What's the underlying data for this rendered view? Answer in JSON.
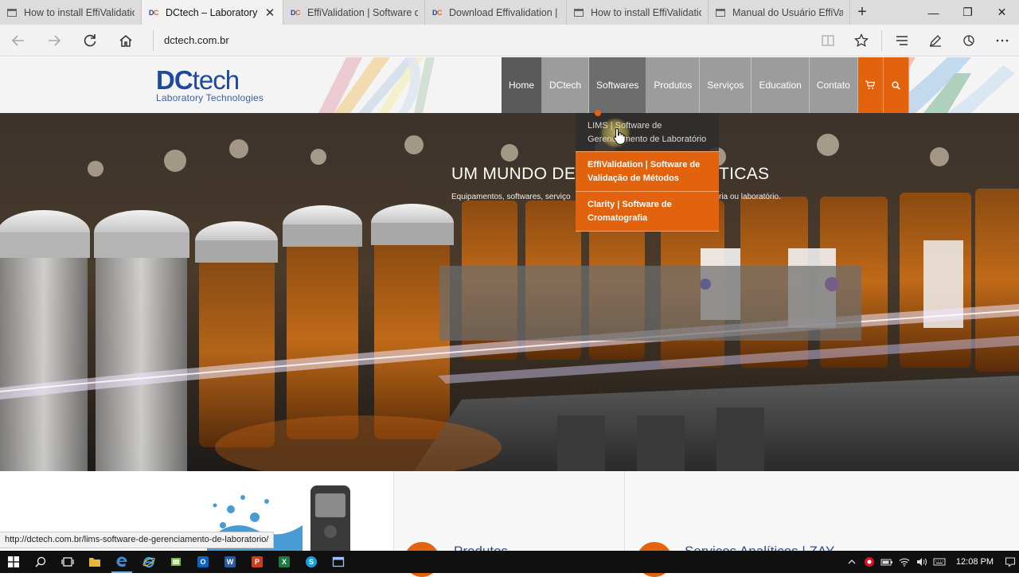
{
  "browser": {
    "tabs": [
      {
        "title": "How to install EffiValidatio",
        "icon": "page-icon",
        "active": false
      },
      {
        "title": "DCtech – Laboratory T",
        "icon": "dctech-favicon",
        "active": true
      },
      {
        "title": "EffiValidation | Software de",
        "icon": "dctech-favicon",
        "active": false
      },
      {
        "title": "Download Effivalidation | I",
        "icon": "dctech-favicon",
        "active": false
      },
      {
        "title": "How to install EffiValidatio",
        "icon": "page-icon",
        "active": false
      },
      {
        "title": "Manual do Usuário EffiVali",
        "icon": "page-icon",
        "active": false
      }
    ],
    "close_glyph": "✕",
    "new_tab_glyph": "+",
    "window_controls": {
      "minimize": "—",
      "maximize": "❐",
      "close": "✕"
    },
    "address": "dctech.com.br",
    "status_url": "http://dctech.com.br/lims-software-de-gerenciamento-de-laboratorio/"
  },
  "site": {
    "logo": {
      "brand_dc": "DC",
      "brand_tech": "tech",
      "tagline": "Laboratory Technologies"
    },
    "nav": {
      "home": "Home",
      "dctech": "DCtech",
      "softwares": "Softwares",
      "produtos": "Produtos",
      "servicos": "Serviços",
      "education": "Education",
      "contato": "Contato"
    },
    "dropdown": [
      {
        "label": "LIMS | Software de Gerenciamento de Laboratório"
      },
      {
        "label": "EffiValidation | Software de Validação de Métodos"
      },
      {
        "label": "Clarity | Software de Cromatografia"
      }
    ],
    "hero": {
      "title_left": "UM MUNDO DE",
      "title_right": "TICAS",
      "subtitle_left": "Equipamentos, softwares, serviço",
      "subtitle_right": "ria ou laboratório."
    },
    "below": {
      "heading_1": "Produtos",
      "heading_2": "Serviços Analíticos | ZAY"
    }
  },
  "taskbar": {
    "clock": "12:08 PM"
  },
  "colors": {
    "brand_blue": "#1e4a9c",
    "brand_orange": "#e2620e",
    "nav_dark": "#5a5a5a",
    "nav_grey": "#9c9c9c"
  }
}
